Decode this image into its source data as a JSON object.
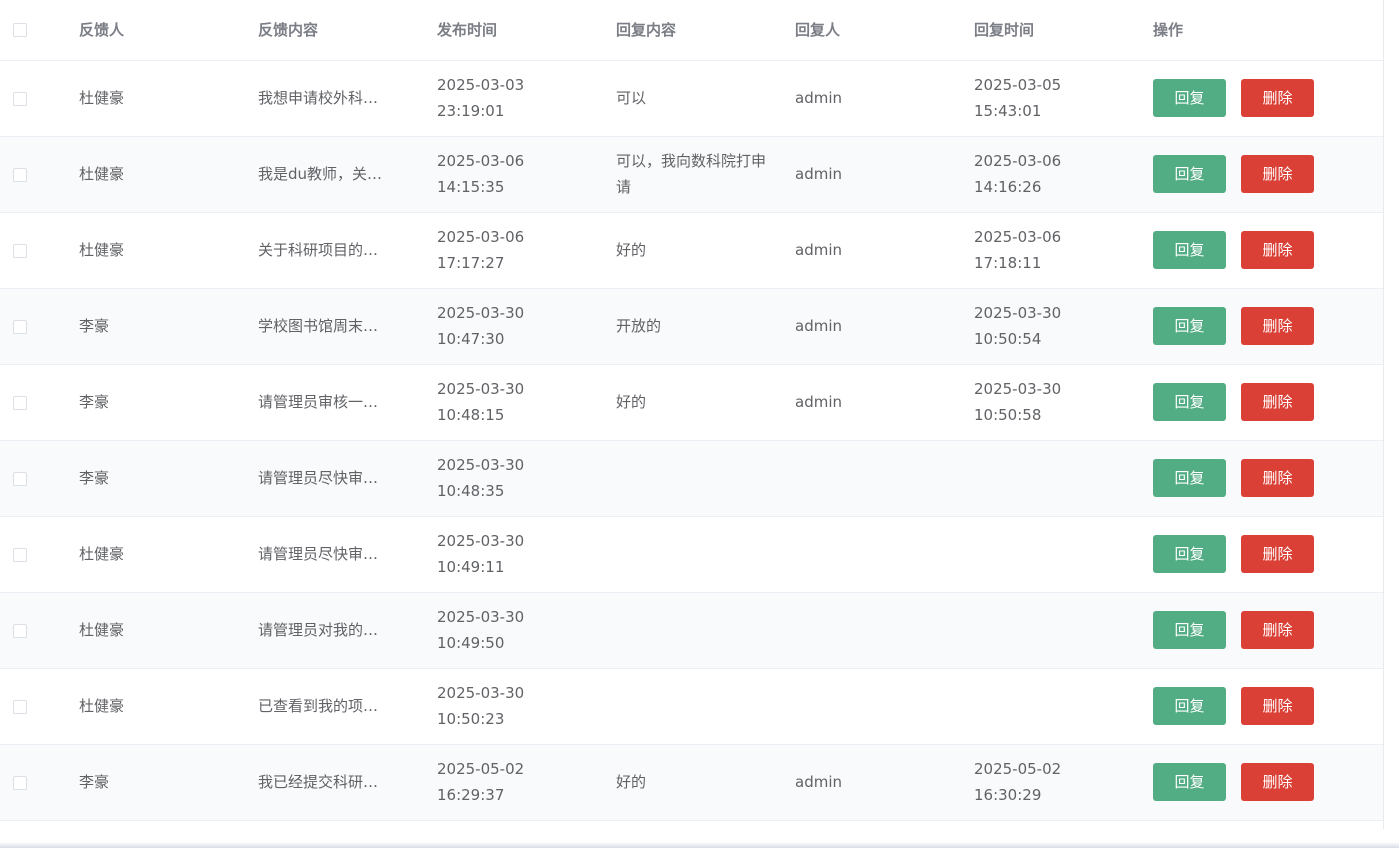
{
  "colors": {
    "reply_button": "#52ac84",
    "delete_button": "#db4037",
    "header_text": "#7b7e86",
    "body_text": "#606266",
    "stripe_row": "#f9fafb"
  },
  "table": {
    "headers": {
      "feedbacker": "反馈人",
      "content": "反馈内容",
      "publish_time": "发布时间",
      "reply_content": "回复内容",
      "replier": "回复人",
      "reply_time": "回复时间",
      "operations": "操作"
    },
    "button_labels": {
      "reply": "回复",
      "delete": "删除"
    },
    "rows": [
      {
        "feedbacker": "杜健豪",
        "content": "我想申请校外科…",
        "publish_time": "2025-03-03 23:19:01",
        "reply_content": "可以",
        "replier": "admin",
        "reply_time": "2025-03-05 15:43:01"
      },
      {
        "feedbacker": "杜健豪",
        "content": "我是du教师，关…",
        "publish_time": "2025-03-06 14:15:35",
        "reply_content": "可以，我向数科院打申请",
        "replier": "admin",
        "reply_time": "2025-03-06 14:16:26"
      },
      {
        "feedbacker": "杜健豪",
        "content": "关于科研项目的…",
        "publish_time": "2025-03-06 17:17:27",
        "reply_content": "好的",
        "replier": "admin",
        "reply_time": "2025-03-06 17:18:11"
      },
      {
        "feedbacker": "李豪",
        "content": "学校图书馆周末…",
        "publish_time": "2025-03-30 10:47:30",
        "reply_content": "开放的",
        "replier": "admin",
        "reply_time": "2025-03-30 10:50:54"
      },
      {
        "feedbacker": "李豪",
        "content": "请管理员审核一…",
        "publish_time": "2025-03-30 10:48:15",
        "reply_content": "好的",
        "replier": "admin",
        "reply_time": "2025-03-30 10:50:58"
      },
      {
        "feedbacker": "李豪",
        "content": "请管理员尽快审…",
        "publish_time": "2025-03-30 10:48:35",
        "reply_content": "",
        "replier": "",
        "reply_time": ""
      },
      {
        "feedbacker": "杜健豪",
        "content": "请管理员尽快审…",
        "publish_time": "2025-03-30 10:49:11",
        "reply_content": "",
        "replier": "",
        "reply_time": ""
      },
      {
        "feedbacker": "杜健豪",
        "content": "请管理员对我的…",
        "publish_time": "2025-03-30 10:49:50",
        "reply_content": "",
        "replier": "",
        "reply_time": ""
      },
      {
        "feedbacker": "杜健豪",
        "content": "已查看到我的项…",
        "publish_time": "2025-03-30 10:50:23",
        "reply_content": "",
        "replier": "",
        "reply_time": ""
      },
      {
        "feedbacker": "李豪",
        "content": "我已经提交科研…",
        "publish_time": "2025-05-02 16:29:37",
        "reply_content": "好的",
        "replier": "admin",
        "reply_time": "2025-05-02 16:30:29"
      }
    ]
  }
}
